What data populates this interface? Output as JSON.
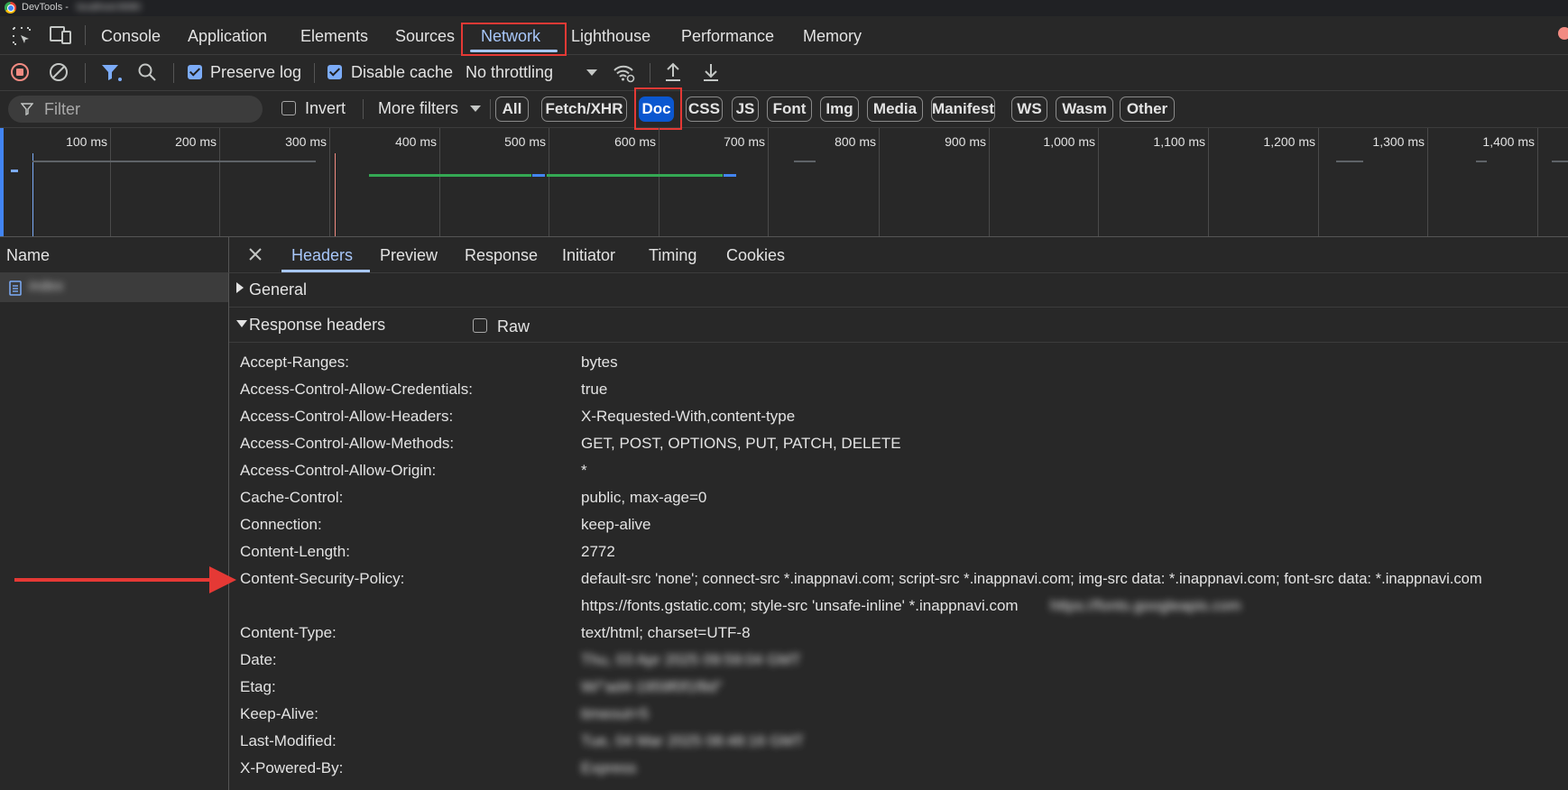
{
  "window": {
    "title": "DevTools -",
    "title_suffix": "localhost:8080"
  },
  "tabs": [
    {
      "label": "Console"
    },
    {
      "label": "Application"
    },
    {
      "label": "Elements"
    },
    {
      "label": "Sources"
    },
    {
      "label": "Network",
      "active": true
    },
    {
      "label": "Lighthouse"
    },
    {
      "label": "Performance"
    },
    {
      "label": "Memory"
    }
  ],
  "toolbar": {
    "preserve_log": "Preserve log",
    "preserve_log_checked": true,
    "disable_cache": "Disable cache",
    "disable_cache_checked": true,
    "throttling": "No throttling"
  },
  "filterbar": {
    "placeholder": "Filter",
    "invert": "Invert",
    "invert_checked": false,
    "more_filters": "More filters",
    "chips": [
      "All",
      "Fetch/XHR",
      "Doc",
      "CSS",
      "JS",
      "Font",
      "Img",
      "Media",
      "Manifest",
      "WS",
      "Wasm",
      "Other"
    ],
    "selected_chip": "Doc"
  },
  "timeline": {
    "ticks": [
      "100 ms",
      "200 ms",
      "300 ms",
      "400 ms",
      "500 ms",
      "600 ms",
      "700 ms",
      "800 ms",
      "900 ms",
      "1,000 ms",
      "1,100 ms",
      "1,200 ms",
      "1,300 ms",
      "1,400 ms"
    ]
  },
  "request_list": {
    "header": "Name",
    "items": [
      {
        "name": "index"
      }
    ]
  },
  "details": {
    "tabs": [
      "Headers",
      "Preview",
      "Response",
      "Initiator",
      "Timing",
      "Cookies"
    ],
    "active_tab": "Headers",
    "general_label": "General",
    "response_headers_label": "Response headers",
    "raw_label": "Raw",
    "headers": [
      {
        "name": "Accept-Ranges:",
        "value": "bytes"
      },
      {
        "name": "Access-Control-Allow-Credentials:",
        "value": "true"
      },
      {
        "name": "Access-Control-Allow-Headers:",
        "value": "X-Requested-With,content-type"
      },
      {
        "name": "Access-Control-Allow-Methods:",
        "value": "GET, POST, OPTIONS, PUT, PATCH, DELETE"
      },
      {
        "name": "Access-Control-Allow-Origin:",
        "value": "*"
      },
      {
        "name": "Cache-Control:",
        "value": "public, max-age=0"
      },
      {
        "name": "Connection:",
        "value": "keep-alive"
      },
      {
        "name": "Content-Length:",
        "value": "2772"
      },
      {
        "name": "Content-Security-Policy:",
        "value": "default-src 'none'; connect-src *.inappnavi.com; script-src *.inappnavi.com; img-src data: *.inappnavi.com; font-src data: *.inappnavi.com",
        "value2": "https://fonts.gstatic.com; style-src 'unsafe-inline' *.inappnavi.com",
        "value2_blurred": "https://fonts.googleapis.com"
      },
      {
        "name": "Content-Type:",
        "value": "text/html; charset=UTF-8"
      },
      {
        "name": "Date:",
        "value": "Thu, 03 Apr 2025 09:59:04 GMT",
        "blurred": true
      },
      {
        "name": "Etag:",
        "value": "W/\"ad4-1959f0f1f8d\"",
        "blurred": true
      },
      {
        "name": "Keep-Alive:",
        "value": "timeout=5",
        "blurred": true
      },
      {
        "name": "Last-Modified:",
        "value": "Tue, 04 Mar 2025 08:48:16 GMT",
        "blurred": true
      },
      {
        "name": "X-Powered-By:",
        "value": "Express",
        "blurred": true
      }
    ]
  }
}
